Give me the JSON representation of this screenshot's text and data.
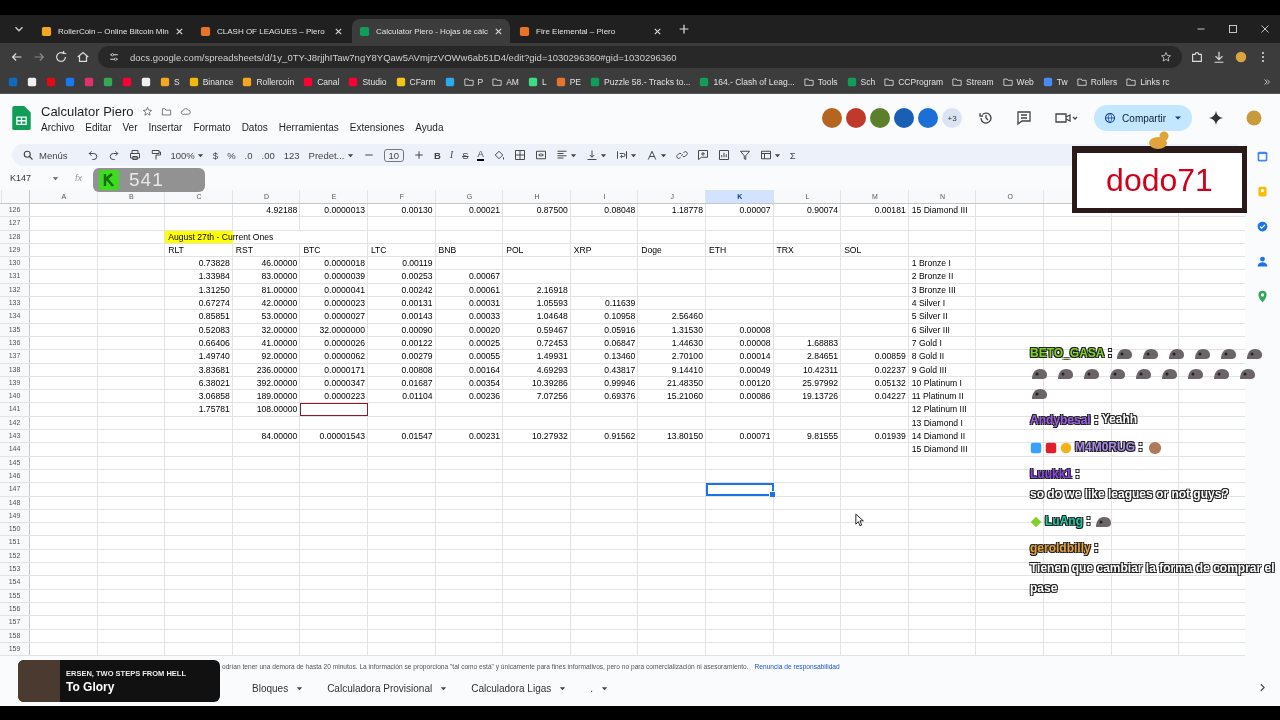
{
  "browser": {
    "tabs": [
      {
        "title": "RollerCoin – Online Bitcoin Min",
        "kind": "coin",
        "selected": false
      },
      {
        "title": "CLASH OF LEAGUES – Piero",
        "kind": "brand",
        "selected": false
      },
      {
        "title": "Calculator Piero - Hojas de cálc",
        "kind": "sheet",
        "selected": true
      },
      {
        "title": "Fire Elemental – Piero",
        "kind": "brand",
        "selected": false
      }
    ],
    "url": "docs.google.com/spreadsheets/d/1y_0TY-J8rjjhITaw7ngY8YQaw5AVmjrzVOWw6ab51D4/edit?gid=1030296360#gid=1030296360",
    "bookmarks": [
      {
        "kind": "mail"
      },
      {
        "kind": "circle"
      },
      {
        "kind": "netflix"
      },
      {
        "kind": "facebook"
      },
      {
        "kind": "instagram"
      },
      {
        "kind": "drive"
      },
      {
        "kind": "youtube"
      },
      {
        "kind": "x"
      },
      {
        "kind": "coin",
        "label": "S"
      },
      {
        "kind": "binance",
        "label": "Binance"
      },
      {
        "kind": "coin",
        "label": "Rollercoin"
      },
      {
        "kind": "youtube",
        "label": "Canal"
      },
      {
        "kind": "youtube",
        "label": "Studio"
      },
      {
        "kind": "face",
        "label": "CFarm"
      },
      {
        "kind": "telegram"
      },
      {
        "kind": "folder",
        "label": "P"
      },
      {
        "kind": "folder",
        "label": "AM"
      },
      {
        "kind": "leaf",
        "label": "L"
      },
      {
        "kind": "brand",
        "label": "PE"
      },
      {
        "kind": "sheet",
        "label": "Puzzle 58.- Tracks to..."
      },
      {
        "kind": "sheet",
        "label": "164.- Clash of Leag..."
      },
      {
        "kind": "folder",
        "label": "Tools"
      },
      {
        "kind": "sheet",
        "label": "Sch"
      },
      {
        "kind": "folder",
        "label": "CCProgram"
      },
      {
        "kind": "folder",
        "label": "Stream"
      },
      {
        "kind": "folder",
        "label": "Web"
      },
      {
        "kind": "list",
        "label": "Tw"
      },
      {
        "kind": "folder",
        "label": "Rollers"
      },
      {
        "kind": "folder",
        "label": "Links rc"
      }
    ]
  },
  "doc": {
    "title": "Calculator Piero",
    "menus": [
      "Archivo",
      "Editar",
      "Ver",
      "Insertar",
      "Formato",
      "Datos",
      "Herramientas",
      "Extensiones",
      "Ayuda"
    ],
    "collaborators": [
      {
        "color": "#b5651d"
      },
      {
        "color": "#c0392b"
      },
      {
        "color": "#5b7f2a"
      },
      {
        "color": "#1a5fb4"
      },
      {
        "color": "#1c6fd6"
      }
    ],
    "more_collaborators": "+3",
    "share": "Compartir"
  },
  "toolbar": [
    {
      "kind": "search",
      "text": "Menús"
    },
    {
      "kind": "undo"
    },
    {
      "kind": "redo"
    },
    {
      "kind": "print"
    },
    {
      "kind": "paint-roller"
    },
    {
      "kind": "dropdown",
      "text": "100%"
    },
    {
      "kind": "text",
      "text": "$"
    },
    {
      "kind": "text",
      "text": "%"
    },
    {
      "kind": "text",
      "text": ".0"
    },
    {
      "kind": "text",
      "text": ".00"
    },
    {
      "kind": "text",
      "text": "123"
    },
    {
      "kind": "dropdown",
      "text": "Predet..."
    },
    {
      "kind": "minus"
    },
    {
      "kind": "field",
      "text": "10"
    },
    {
      "kind": "plus"
    },
    {
      "kind": "bold",
      "text": "B"
    },
    {
      "kind": "italic",
      "text": "I"
    },
    {
      "kind": "strike",
      "text": "S"
    },
    {
      "kind": "textcolor",
      "text": "A"
    },
    {
      "kind": "paint-bucket"
    },
    {
      "kind": "borders"
    },
    {
      "kind": "merge"
    },
    {
      "kind": "align"
    },
    {
      "kind": "vertical-align"
    },
    {
      "kind": "text-wrap"
    },
    {
      "kind": "text-rotate"
    },
    {
      "kind": "link"
    },
    {
      "kind": "comment"
    },
    {
      "kind": "chart"
    },
    {
      "kind": "filter"
    },
    {
      "kind": "table"
    },
    {
      "kind": "text",
      "text": "Σ"
    }
  ],
  "formula_bar": {
    "name_box": "K147",
    "label": "fx"
  },
  "sheet": {
    "columns": [
      {
        "label": "A",
        "selected": false
      },
      {
        "label": "B",
        "selected": false
      },
      {
        "label": "C",
        "selected": false
      },
      {
        "label": "D",
        "selected": false
      },
      {
        "label": "E",
        "selected": false
      },
      {
        "label": "F",
        "selected": false
      },
      {
        "label": "G",
        "selected": false
      },
      {
        "label": "H",
        "selected": false
      },
      {
        "label": "I",
        "selected": false
      },
      {
        "label": "J",
        "selected": false
      },
      {
        "label": "K",
        "selected": true
      },
      {
        "label": "L",
        "selected": false
      },
      {
        "label": "M",
        "selected": false
      },
      {
        "label": "N",
        "selected": false
      },
      {
        "label": "O",
        "selected": false
      }
    ],
    "rows": [
      {
        "num": "126",
        "cells": [
          null,
          null,
          null,
          {
            "kind": "num",
            "text": "4.92188"
          },
          {
            "kind": "num",
            "text": "0.0000013"
          },
          {
            "kind": "num",
            "text": "0.00130"
          },
          {
            "kind": "num",
            "text": "0.00021"
          },
          {
            "kind": "num",
            "text": "0.87500"
          },
          {
            "kind": "num",
            "text": "0.08048"
          },
          {
            "kind": "num",
            "text": "1.18778"
          },
          {
            "kind": "num",
            "text": "0.00007"
          },
          {
            "kind": "num",
            "text": "0.90074"
          },
          {
            "kind": "num",
            "text": "0.00181"
          },
          {
            "kind": "label",
            "text": "15 Diamond III"
          }
        ]
      },
      {
        "num": "127"
      },
      {
        "num": "128",
        "cells": [
          null,
          null,
          {
            "kind": "highlight",
            "text": "August 27th - Current Ones"
          }
        ]
      },
      {
        "num": "129",
        "cells": [
          null,
          null,
          {
            "kind": "label",
            "text": "RLT"
          },
          {
            "kind": "label",
            "text": "RST"
          },
          {
            "kind": "label",
            "text": "BTC"
          },
          {
            "kind": "label",
            "text": "LTC"
          },
          {
            "kind": "label",
            "text": "BNB"
          },
          {
            "kind": "label",
            "text": "POL"
          },
          {
            "kind": "label",
            "text": "XRP"
          },
          {
            "kind": "label",
            "text": "Doge"
          },
          {
            "kind": "label",
            "text": "ETH"
          },
          {
            "kind": "label",
            "text": "TRX"
          },
          {
            "kind": "label",
            "text": "SOL"
          }
        ]
      },
      {
        "num": "130",
        "cells": [
          null,
          null,
          {
            "kind": "num",
            "text": "0.73828"
          },
          {
            "kind": "num",
            "text": "46.00000"
          },
          {
            "kind": "num",
            "text": "0.0000018"
          },
          {
            "kind": "num",
            "text": "0.00119"
          },
          null,
          null,
          null,
          null,
          null,
          null,
          null,
          {
            "kind": "label",
            "text": "1 Bronze I"
          }
        ]
      },
      {
        "num": "131",
        "cells": [
          null,
          null,
          {
            "kind": "num",
            "text": "1.33984"
          },
          {
            "kind": "num",
            "text": "83.00000"
          },
          {
            "kind": "num",
            "text": "0.0000039"
          },
          {
            "kind": "num",
            "text": "0.00253"
          },
          {
            "kind": "num",
            "text": "0.00067"
          },
          null,
          null,
          null,
          null,
          null,
          null,
          {
            "kind": "label",
            "text": "2 Bronze II"
          }
        ]
      },
      {
        "num": "132",
        "cells": [
          null,
          null,
          {
            "kind": "num",
            "text": "1.31250"
          },
          {
            "kind": "num",
            "text": "81.00000"
          },
          {
            "kind": "num",
            "text": "0.0000041"
          },
          {
            "kind": "num",
            "text": "0.00242"
          },
          {
            "kind": "num",
            "text": "0.00061"
          },
          {
            "kind": "num",
            "text": "2.16918"
          },
          null,
          null,
          null,
          null,
          null,
          {
            "kind": "label",
            "text": "3 Bronze III"
          }
        ]
      },
      {
        "num": "133",
        "cells": [
          null,
          null,
          {
            "kind": "num",
            "text": "0.67274"
          },
          {
            "kind": "num",
            "text": "42.00000"
          },
          {
            "kind": "num",
            "text": "0.0000023"
          },
          {
            "kind": "num",
            "text": "0.00131"
          },
          {
            "kind": "num",
            "text": "0.00031"
          },
          {
            "kind": "num",
            "text": "1.05593"
          },
          {
            "kind": "num",
            "text": "0.11639"
          },
          null,
          null,
          null,
          null,
          {
            "kind": "label",
            "text": "4 Silver I"
          }
        ]
      },
      {
        "num": "134",
        "cells": [
          null,
          null,
          {
            "kind": "num",
            "text": "0.85851"
          },
          {
            "kind": "num",
            "text": "53.00000"
          },
          {
            "kind": "num",
            "text": "0.0000027"
          },
          {
            "kind": "num",
            "text": "0.00143"
          },
          {
            "kind": "num",
            "text": "0.00033"
          },
          {
            "kind": "num",
            "text": "1.04648"
          },
          {
            "kind": "num",
            "text": "0.10958"
          },
          {
            "kind": "num",
            "text": "2.56460"
          },
          null,
          null,
          null,
          {
            "kind": "label",
            "text": "5 Silver II"
          }
        ]
      },
      {
        "num": "135",
        "cells": [
          null,
          null,
          {
            "kind": "num",
            "text": "0.52083"
          },
          {
            "kind": "num",
            "text": "32.00000"
          },
          {
            "kind": "num",
            "text": "32.0000000"
          },
          {
            "kind": "num",
            "text": "0.00090"
          },
          {
            "kind": "num",
            "text": "0.00020"
          },
          {
            "kind": "num",
            "text": "0.59467"
          },
          {
            "kind": "num",
            "text": "0.05916"
          },
          {
            "kind": "num",
            "text": "1.31530"
          },
          {
            "kind": "num",
            "text": "0.00008"
          },
          null,
          null,
          {
            "kind": "label",
            "text": "6 Silver III"
          }
        ]
      },
      {
        "num": "136",
        "cells": [
          null,
          null,
          {
            "kind": "num",
            "text": "0.66406"
          },
          {
            "kind": "num",
            "text": "41.00000"
          },
          {
            "kind": "num",
            "text": "0.0000026"
          },
          {
            "kind": "num",
            "text": "0.00122"
          },
          {
            "kind": "num",
            "text": "0.00025"
          },
          {
            "kind": "num",
            "text": "0.72453"
          },
          {
            "kind": "num",
            "text": "0.06847"
          },
          {
            "kind": "num",
            "text": "1.44630"
          },
          {
            "kind": "num",
            "text": "0.00008"
          },
          {
            "kind": "num",
            "text": "1.68883"
          },
          null,
          {
            "kind": "label",
            "text": "7 Gold I"
          }
        ]
      },
      {
        "num": "137",
        "cells": [
          null,
          null,
          {
            "kind": "num",
            "text": "1.49740"
          },
          {
            "kind": "num",
            "text": "92.00000"
          },
          {
            "kind": "num",
            "text": "0.0000062"
          },
          {
            "kind": "num",
            "text": "0.00279"
          },
          {
            "kind": "num",
            "text": "0.00055"
          },
          {
            "kind": "num",
            "text": "1.49931"
          },
          {
            "kind": "num",
            "text": "0.13460"
          },
          {
            "kind": "num",
            "text": "2.70100"
          },
          {
            "kind": "num",
            "text": "0.00014"
          },
          {
            "kind": "num",
            "text": "2.84651"
          },
          {
            "kind": "num",
            "text": "0.00859"
          },
          {
            "kind": "label",
            "text": "8 Gold II"
          }
        ]
      },
      {
        "num": "138",
        "cells": [
          null,
          null,
          {
            "kind": "num",
            "text": "3.83681"
          },
          {
            "kind": "num",
            "text": "236.00000"
          },
          {
            "kind": "num",
            "text": "0.0000171"
          },
          {
            "kind": "num",
            "text": "0.00808"
          },
          {
            "kind": "num",
            "text": "0.00164"
          },
          {
            "kind": "num",
            "text": "4.69293"
          },
          {
            "kind": "num",
            "text": "0.43817"
          },
          {
            "kind": "num",
            "text": "9.14410"
          },
          {
            "kind": "num",
            "text": "0.00049"
          },
          {
            "kind": "num",
            "text": "10.42311"
          },
          {
            "kind": "num",
            "text": "0.02237"
          },
          {
            "kind": "label",
            "text": "9 Gold III"
          }
        ]
      },
      {
        "num": "139",
        "cells": [
          null,
          null,
          {
            "kind": "num",
            "text": "6.38021"
          },
          {
            "kind": "num",
            "text": "392.00000"
          },
          {
            "kind": "num",
            "text": "0.0000347"
          },
          {
            "kind": "num",
            "text": "0.01687"
          },
          {
            "kind": "num",
            "text": "0.00354"
          },
          {
            "kind": "num",
            "text": "10.39286"
          },
          {
            "kind": "num",
            "text": "0.99946"
          },
          {
            "kind": "num",
            "text": "21.48350"
          },
          {
            "kind": "num",
            "text": "0.00120"
          },
          {
            "kind": "num",
            "text": "25.97992"
          },
          {
            "kind": "num",
            "text": "0.05132"
          },
          {
            "kind": "label",
            "text": "10 Platinum I"
          }
        ]
      },
      {
        "num": "140",
        "cells": [
          null,
          null,
          {
            "kind": "num",
            "text": "3.06858"
          },
          {
            "kind": "num",
            "text": "189.00000"
          },
          {
            "kind": "num",
            "text": "0.0000223"
          },
          {
            "kind": "num",
            "text": "0.01104"
          },
          {
            "kind": "num",
            "text": "0.00236"
          },
          {
            "kind": "num",
            "text": "7.07256"
          },
          {
            "kind": "num",
            "text": "0.69376"
          },
          {
            "kind": "num",
            "text": "15.21060"
          },
          {
            "kind": "num",
            "text": "0.00086"
          },
          {
            "kind": "num",
            "text": "19.13726"
          },
          {
            "kind": "num",
            "text": "0.04227"
          },
          {
            "kind": "label",
            "text": "11 Platinum II"
          }
        ]
      },
      {
        "num": "141",
        "cells": [
          null,
          null,
          {
            "kind": "num",
            "text": "1.75781"
          },
          {
            "kind": "num",
            "text": "108.00000"
          },
          {
            "kind": "flagged"
          },
          null,
          null,
          null,
          null,
          null,
          null,
          null,
          null,
          {
            "kind": "label",
            "text": "12 Platinum III"
          }
        ]
      },
      {
        "num": "142",
        "cells": [
          null,
          null,
          null,
          null,
          null,
          null,
          null,
          null,
          null,
          null,
          null,
          null,
          null,
          {
            "kind": "label",
            "text": "13 Diamond I"
          }
        ]
      },
      {
        "num": "143",
        "cells": [
          null,
          null,
          null,
          {
            "kind": "num",
            "text": "84.00000"
          },
          {
            "kind": "num",
            "text": "0.00001543"
          },
          {
            "kind": "num",
            "text": "0.01547"
          },
          {
            "kind": "num",
            "text": "0.00231"
          },
          {
            "kind": "num",
            "text": "10.27932"
          },
          {
            "kind": "num",
            "text": "0.91562"
          },
          {
            "kind": "num",
            "text": "13.80150"
          },
          {
            "kind": "num",
            "text": "0.00071"
          },
          {
            "kind": "num",
            "text": "9.81555"
          },
          {
            "kind": "num",
            "text": "0.01939"
          },
          {
            "kind": "label",
            "text": "14 Diamond II"
          }
        ]
      },
      {
        "num": "144",
        "cells": [
          null,
          null,
          null,
          null,
          null,
          null,
          null,
          null,
          null,
          null,
          null,
          null,
          null,
          {
            "kind": "label",
            "text": "15 Diamond III"
          }
        ]
      },
      {
        "num": "145"
      },
      {
        "num": "146"
      },
      {
        "num": "147",
        "cells": [
          null,
          null,
          null,
          null,
          null,
          null,
          null,
          null,
          null,
          null,
          {
            "kind": "cursor"
          }
        ]
      },
      {
        "num": "148"
      },
      {
        "num": "149"
      },
      {
        "num": "150"
      },
      {
        "num": "151"
      },
      {
        "num": "152"
      },
      {
        "num": "153"
      },
      {
        "num": "154"
      },
      {
        "num": "155"
      },
      {
        "num": "156"
      },
      {
        "num": "157"
      },
      {
        "num": "158"
      },
      {
        "num": "159"
      }
    ]
  },
  "disclaimer": {
    "text": "odrían tener una demora de hasta 20 minutos. La información se proporciona \"tal como está\" y únicamente para fines informativos, pero no para comercialización ni asesoramiento.",
    "link": "Renuncia de responsabilidad"
  },
  "sheet_tabs": [
    {
      "label": "Bloques",
      "selected": false
    },
    {
      "label": "Calculadora Provisional",
      "selected": false
    },
    {
      "label": "Calculadora Ligas",
      "selected": false
    },
    {
      "label": ".",
      "selected": false
    }
  ],
  "overlays": {
    "counter": "541",
    "streamer": "dodo71",
    "now_playing": {
      "artist": "ERSEN, TWO STEPS FROM HELL",
      "track": "To Glory"
    }
  },
  "chat": [
    {
      "user": "BETO_GASA",
      "color": "#7ed321",
      "separator": ":",
      "parts": [
        {
          "kind": "emote"
        },
        {
          "kind": "emote"
        },
        {
          "kind": "emote"
        },
        {
          "kind": "emote"
        },
        {
          "kind": "emote"
        },
        {
          "kind": "emote"
        },
        {
          "kind": "emote"
        },
        {
          "kind": "emote"
        },
        {
          "kind": "emote"
        },
        {
          "kind": "emote"
        },
        {
          "kind": "emote"
        },
        {
          "kind": "emote"
        },
        {
          "kind": "emote"
        },
        {
          "kind": "emote"
        },
        {
          "kind": "emote"
        },
        {
          "kind": "emote"
        }
      ]
    },
    {
      "user": "Andybesal",
      "color": "#9b5de5",
      "separator": ":",
      "parts": [
        {
          "kind": "text",
          "text": "Yeahh"
        }
      ]
    },
    {
      "user": "M4M0RUG",
      "color": "#a98be8",
      "separator": ":",
      "badges": [
        {
          "kind": "cube"
        },
        {
          "kind": "tv"
        },
        {
          "kind": "coin"
        }
      ],
      "parts": [
        {
          "kind": "face"
        }
      ]
    },
    {
      "user": "Luukk1",
      "color": "#8e44ec",
      "separator": ":",
      "parts": [
        {
          "kind": "text",
          "text": "so do we like leagues or not guys?"
        }
      ]
    },
    {
      "user": "LuAng",
      "color": "#1fc6a0",
      "separator": ":",
      "badges": [
        {
          "kind": "diamond"
        }
      ],
      "parts": [
        {
          "kind": "emote"
        }
      ]
    },
    {
      "user": "geroldbilly",
      "color": "#e8a13a",
      "separator": ":",
      "parts": [
        {
          "kind": "text",
          "text": "Tienen que cambiar la forma de comprar el pase"
        }
      ]
    }
  ]
}
